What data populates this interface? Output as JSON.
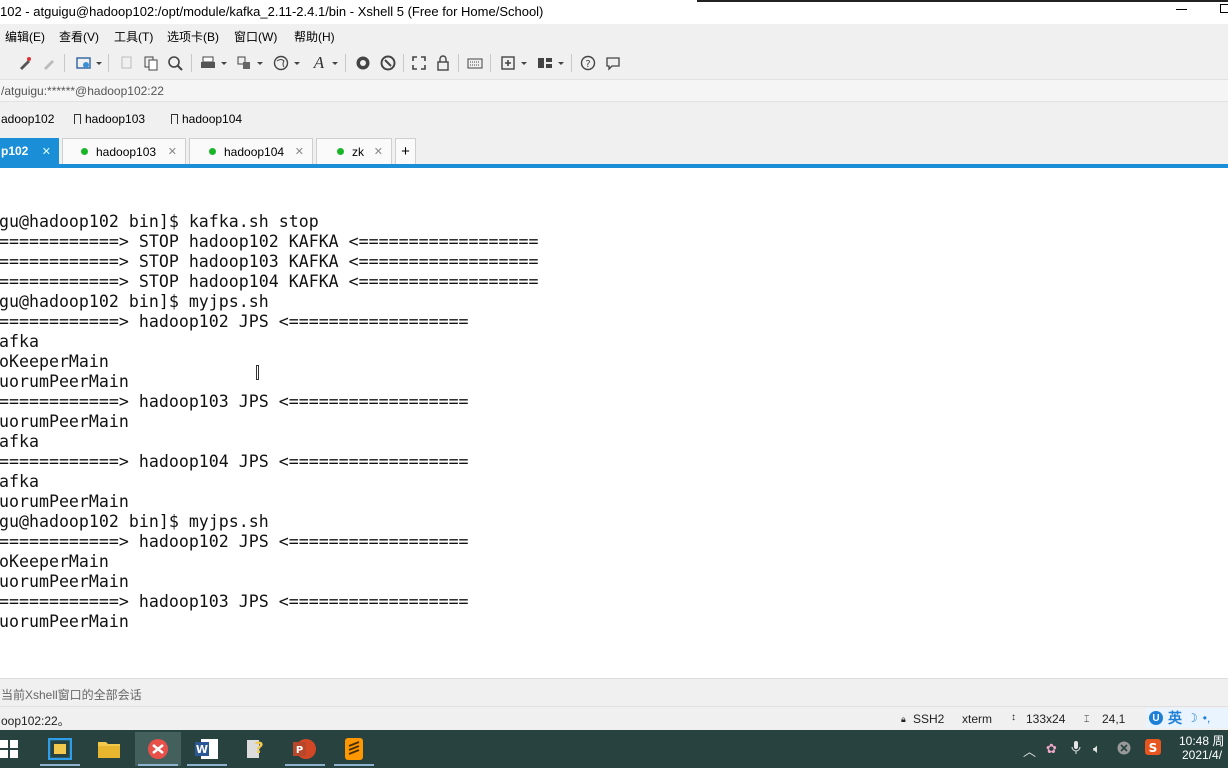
{
  "window": {
    "title": "102 - atguigu@hadoop102:/opt/module/kafka_2.11-2.4.1/bin - Xshell 5 (Free for Home/School)"
  },
  "menu": [
    "编辑(E)",
    "查看(V)",
    "工具(T)",
    "选项卡(B)",
    "窗口(W)",
    "帮助(H)"
  ],
  "toolbar_icons": [
    "pen-icon",
    "pen-disabled-icon",
    "new-session-icon",
    "copy-icon",
    "paste-icon",
    "find-icon",
    "print-icon",
    "transfer-icon",
    "globe-icon",
    "font-icon",
    "xftp-icon",
    "xmanager-icon",
    "fullscreen-icon",
    "lock-icon",
    "keyboard-icon",
    "compose-icon",
    "layout-icon",
    "help-icon",
    "chat-icon"
  ],
  "address": "/atguigu:******@hadoop102:22",
  "links": [
    {
      "label": "adoop102",
      "bookmark": false
    },
    {
      "label": "hadoop103",
      "bookmark": true
    },
    {
      "label": "hadoop104",
      "bookmark": true
    }
  ],
  "tabs": [
    {
      "label": "p102",
      "active": true
    },
    {
      "label": "hadoop103",
      "active": false
    },
    {
      "label": "hadoop104",
      "active": false
    },
    {
      "label": "zk",
      "active": false
    }
  ],
  "tab_add": "+",
  "terminal": {
    "lines": [
      "gu@hadoop102 bin]$ kafka.sh stop",
      "============> STOP hadoop102 KAFKA <==================",
      "============> STOP hadoop103 KAFKA <==================",
      "============> STOP hadoop104 KAFKA <==================",
      "gu@hadoop102 bin]$ myjps.sh",
      "============> hadoop102 JPS <==================",
      "afka",
      "oKeeperMain",
      "uorumPeerMain",
      "============> hadoop103 JPS <==================",
      "uorumPeerMain",
      "afka",
      "============> hadoop104 JPS <==================",
      "afka",
      "uorumPeerMain",
      "gu@hadoop102 bin]$ myjps.sh",
      "============> hadoop102 JPS <==================",
      "oKeeperMain",
      "uorumPeerMain",
      "============> hadoop103 JPS <==================",
      "uorumPeerMain"
    ]
  },
  "compose": "当前Xshell窗口的全部会话",
  "status": {
    "session": "oop102:22。",
    "protocol": "SSH2",
    "term_type": "xterm",
    "size": "133x24",
    "cursor": "24,1"
  },
  "ime": {
    "lang": "英",
    "logo": "U"
  },
  "taskbar": {
    "apps": [
      "windows-start-icon",
      "explorer-window-icon",
      "file-explorer-icon",
      "xshell-icon",
      "word-icon",
      "help-tool-icon",
      "powerpoint-icon",
      "sublime-icon"
    ],
    "time": "10:48 周",
    "date": "2021/4/"
  },
  "colors": {
    "accent": "#1a8fd8",
    "status_dot": "#1ab62a",
    "taskbar": "#27423f"
  }
}
